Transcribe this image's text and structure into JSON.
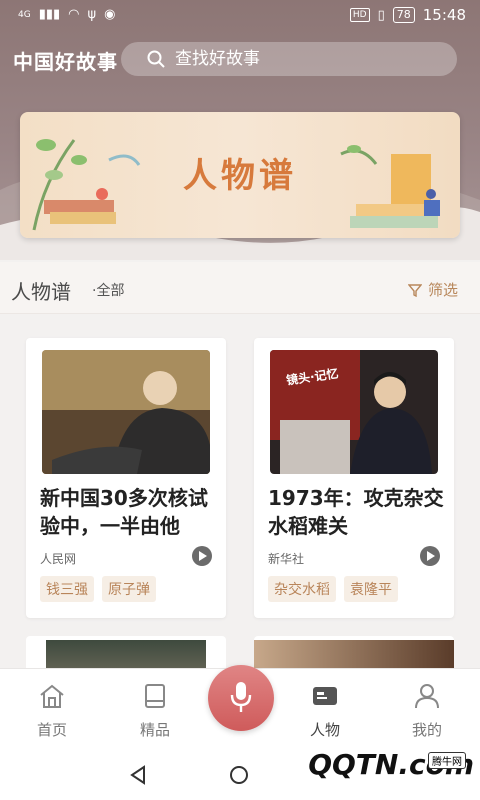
{
  "status_bar": {
    "network": "4G",
    "battery": "78",
    "hd": "HD",
    "time": "15:48"
  },
  "header": {
    "app_title": "中国好故事",
    "search_placeholder": "查找好故事"
  },
  "banner": {
    "title": "人物谱"
  },
  "section": {
    "title": "人物谱",
    "subtitle": "·全部",
    "filter_label": "筛选"
  },
  "cards": [
    {
      "title": "新中国30多次核试验中，一半由他",
      "source": "人民网",
      "tags": [
        "钱三强",
        "原子弹"
      ]
    },
    {
      "title": "1973年：攻克杂交水稻难关",
      "source": "新华社",
      "tags": [
        "杂交水稻",
        "袁隆平"
      ],
      "image_caption": "镜头·记忆"
    }
  ],
  "nav": {
    "items": [
      {
        "label": "首页",
        "icon": "home-icon"
      },
      {
        "label": "精品",
        "icon": "book-icon"
      },
      {
        "label": "",
        "icon": "microphone-icon"
      },
      {
        "label": "人物",
        "icon": "id-card-icon"
      },
      {
        "label": "我的",
        "icon": "user-icon"
      }
    ]
  },
  "watermark": {
    "text": "QQTN.com",
    "small": "腾牛网"
  },
  "colors": {
    "header": "#8d7675",
    "accent": "#d77a3c",
    "tag_text": "#b9855a",
    "mic": "#d96868"
  }
}
